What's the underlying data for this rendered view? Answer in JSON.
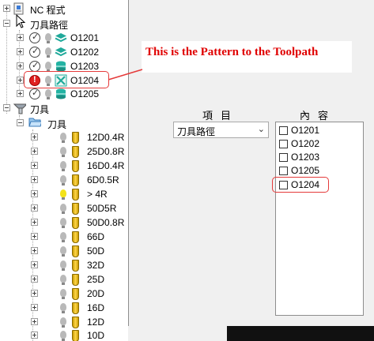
{
  "tree": {
    "nc_program": "NC 程式",
    "toolpath_group": "刀具路徑",
    "toolpaths": [
      "O1201",
      "O1202",
      "O1203",
      "O1204",
      "O1205"
    ],
    "tools_group": "刀具",
    "tools_folder": "刀具",
    "tools": [
      "12D0.4R",
      "25D0.8R",
      "16D0.4R",
      "6D0.5R",
      "> 4R",
      "50D5R",
      "50D0.8R",
      "66D",
      "50D",
      "32D",
      "25D",
      "20D",
      "16D",
      "12D",
      "10D"
    ]
  },
  "panel": {
    "header_item": "項目",
    "header_content": "內容",
    "select_value": "刀具路徑",
    "list_items": [
      "O1201",
      "O1202",
      "O1203",
      "O1205",
      "O1204"
    ]
  },
  "annotation": {
    "note": "This is the Pattern to the Toolpath",
    "color": "#e00000"
  }
}
